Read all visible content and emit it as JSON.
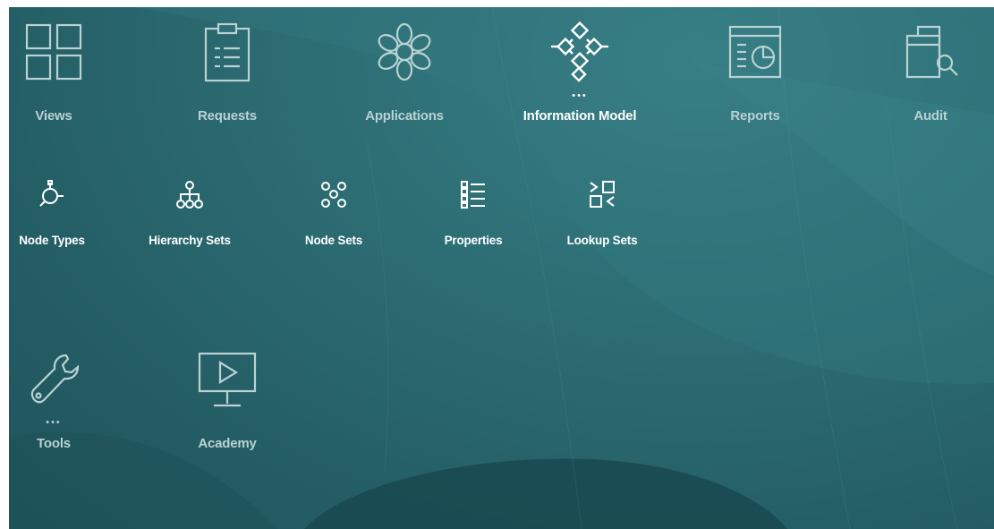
{
  "nav": {
    "views": {
      "label": "Views"
    },
    "requests": {
      "label": "Requests"
    },
    "applications": {
      "label": "Applications"
    },
    "information_model": {
      "label": "Information Model",
      "more": "•••"
    },
    "reports": {
      "label": "Reports"
    },
    "audit": {
      "label": "Audit"
    }
  },
  "submenu": {
    "node_types": {
      "label": "Node Types"
    },
    "hierarchy_sets": {
      "label": "Hierarchy Sets"
    },
    "node_sets": {
      "label": "Node Sets"
    },
    "properties": {
      "label": "Properties"
    },
    "lookup_sets": {
      "label": "Lookup Sets"
    }
  },
  "bottom": {
    "tools": {
      "label": "Tools",
      "more": "•••"
    },
    "academy": {
      "label": "Academy"
    }
  },
  "colors": {
    "background": "#2e6f76",
    "active_text": "#ffffff",
    "inactive_text": "#b9d2d3"
  },
  "icons": {
    "views": "grid-icon",
    "requests": "clipboard-icon",
    "applications": "flower-icon",
    "information_model": "diamond-network-icon",
    "reports": "report-chart-icon",
    "audit": "audit-search-icon",
    "node_types": "node-type-icon",
    "hierarchy_sets": "hierarchy-icon",
    "node_sets": "node-set-icon",
    "properties": "properties-list-icon",
    "lookup_sets": "lookup-icon",
    "tools": "wrench-icon",
    "academy": "monitor-play-icon"
  }
}
